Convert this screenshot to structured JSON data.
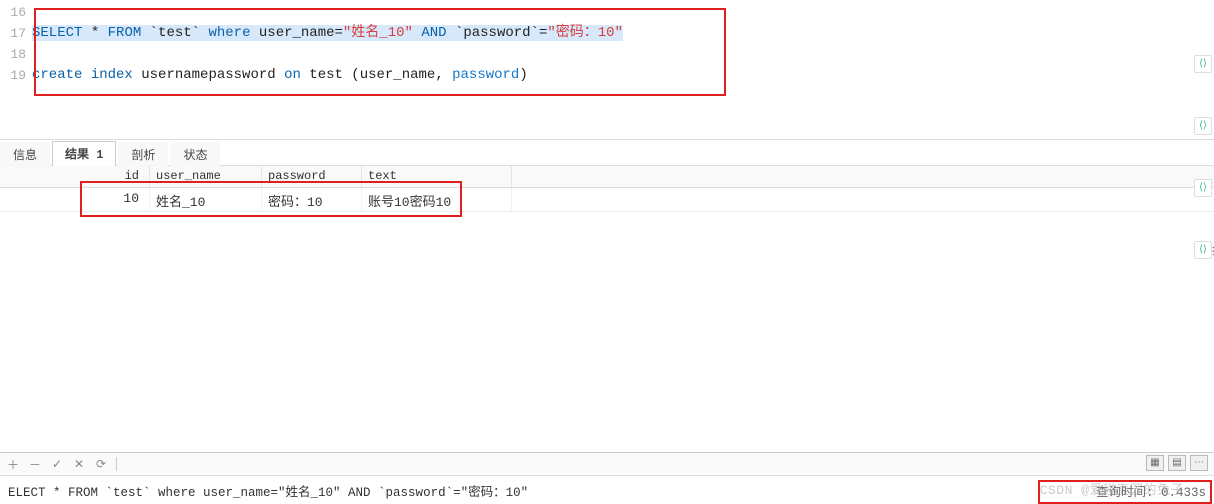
{
  "editor": {
    "lines": [
      {
        "num": "16",
        "tokens": []
      },
      {
        "num": "17",
        "tokens": [
          {
            "t": "SELECT",
            "c": "kw"
          },
          {
            "t": " * ",
            "c": "plain"
          },
          {
            "t": "FROM",
            "c": "kw"
          },
          {
            "t": " `test` ",
            "c": "plain"
          },
          {
            "t": "where",
            "c": "kw"
          },
          {
            "t": " user_name=",
            "c": "plain"
          },
          {
            "t": "\"姓名_10\"",
            "c": "str"
          },
          {
            "t": " ",
            "c": "plain"
          },
          {
            "t": "AND",
            "c": "kw"
          },
          {
            "t": " `password`=",
            "c": "plain"
          },
          {
            "t": "\"密码：10\"",
            "c": "str"
          }
        ],
        "selected": true
      },
      {
        "num": "18",
        "tokens": []
      },
      {
        "num": "19",
        "tokens": [
          {
            "t": "create",
            "c": "kw"
          },
          {
            "t": " ",
            "c": "plain"
          },
          {
            "t": "index",
            "c": "kw"
          },
          {
            "t": " usernamepassword ",
            "c": "plain"
          },
          {
            "t": "on",
            "c": "kw"
          },
          {
            "t": " test (user_name, ",
            "c": "plain"
          },
          {
            "t": "password",
            "c": "builtin"
          },
          {
            "t": ")",
            "c": "plain"
          }
        ]
      }
    ]
  },
  "tabs": {
    "items": [
      {
        "label": "信息",
        "active": false
      },
      {
        "label": "结果 1",
        "active": true
      },
      {
        "label": "剖析",
        "active": false
      },
      {
        "label": "状态",
        "active": false
      }
    ]
  },
  "grid": {
    "headers": {
      "id": "id",
      "user_name": "user_name",
      "password": "password",
      "text": "text"
    },
    "rows": [
      {
        "id": "10",
        "user_name": "姓名_10",
        "password": "密码：10",
        "text": "账号10密码10"
      }
    ]
  },
  "toolbar": {
    "icons": [
      "plus",
      "minus",
      "check",
      "cross",
      "refresh"
    ]
  },
  "status": {
    "query": "ELECT * FROM `test` where user_name=\"姓名_10\" AND `password`=\"密码：10\"",
    "time_label": "查询时间: 0.433s"
  },
  "watermark": "CSDN @爱碰壶园的兔子",
  "view_icons": [
    "grid",
    "form",
    "more"
  ],
  "right_ext_label": "扩"
}
